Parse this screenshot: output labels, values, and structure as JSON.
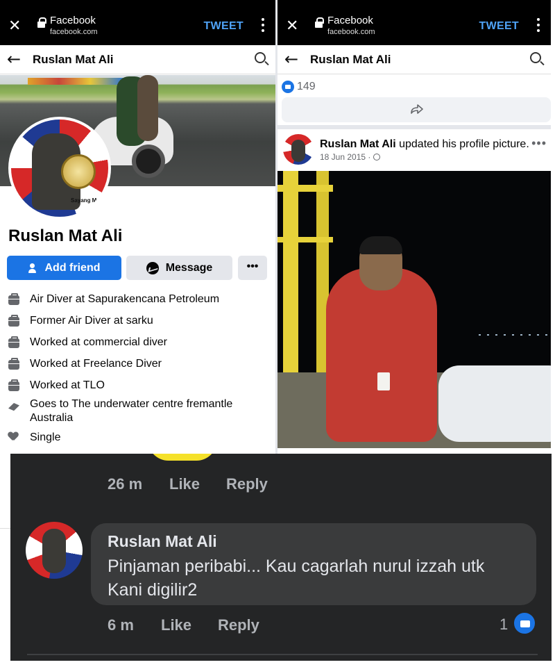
{
  "browser": {
    "site": "Facebook",
    "url": "facebook.com",
    "action_label": "TWEET"
  },
  "nav": {
    "title": "Ruslan Mat Ali"
  },
  "profile": {
    "name": "Ruslan Mat Ali",
    "avatar_caption": "Sayang Ma",
    "add_friend_label": "Add friend",
    "message_label": "Message",
    "more_label": "•••",
    "details": [
      {
        "icon": "briefcase-icon",
        "text": "Air Diver at Sapurakencana Petroleum"
      },
      {
        "icon": "briefcase-icon",
        "text": "Former Air Diver at sarku"
      },
      {
        "icon": "briefcase-icon",
        "text": "Worked at commercial diver"
      },
      {
        "icon": "briefcase-icon",
        "text": "Worked at Freelance Diver"
      },
      {
        "icon": "briefcase-icon",
        "text": "Worked at TLO"
      },
      {
        "icon": "graduation-cap-icon",
        "text": "Goes to The underwater centre fremantle Australia"
      },
      {
        "icon": "heart-icon",
        "text": "Single"
      }
    ]
  },
  "feed": {
    "like_count": "149",
    "post": {
      "author": "Ruslan Mat Ali",
      "action": "updated his profile picture.",
      "date": "18 Jun 2015",
      "more_label": "•••"
    }
  },
  "comments": {
    "first_meta": {
      "time": "26 m",
      "like": "Like",
      "reply": "Reply"
    },
    "comment": {
      "author": "Ruslan Mat Ali",
      "text_line1": "Pinjaman peribabi... Kau cagarlah nurul izzah utk",
      "text_line2": "Kani digilir2",
      "time": "6 m",
      "like": "Like",
      "reply": "Reply",
      "reaction_count": "1"
    }
  },
  "colors": {
    "accent": "#1b74e4",
    "dark_bg": "#242526",
    "bubble_bg": "#3a3b3c",
    "tweet_blue": "#4fa3f7"
  }
}
